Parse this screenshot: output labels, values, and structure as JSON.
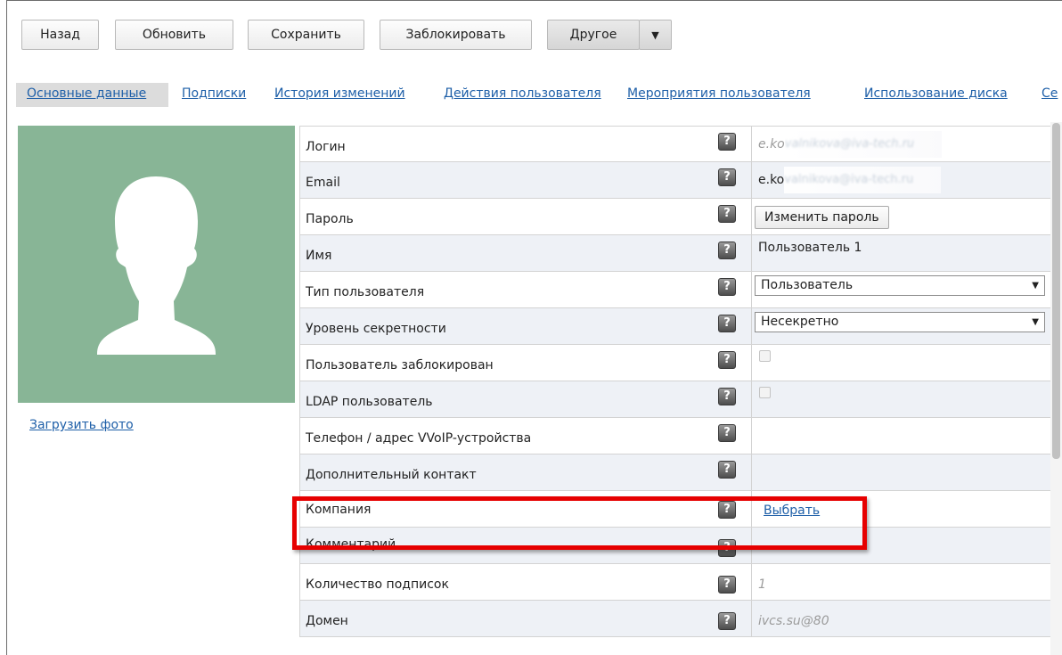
{
  "toolbar": {
    "back": "Назад",
    "refresh": "Обновить",
    "save": "Сохранить",
    "block": "Заблокировать",
    "other": "Другое",
    "other_arrow": "▼"
  },
  "tabs": [
    {
      "label": "Основные данные",
      "active": true
    },
    {
      "label": "Подписки"
    },
    {
      "label": "История изменений"
    },
    {
      "label": "Действия пользователя"
    },
    {
      "label": "Мероприятия пользователя"
    },
    {
      "label": "Использование диска"
    },
    {
      "label": "Се"
    }
  ],
  "avatar": {
    "bg_color": "#88b596",
    "icon": "user-silhouette-icon"
  },
  "upload_photo": "Загрузить фото",
  "help_symbol": "?",
  "fields": {
    "login": {
      "label": "Логин",
      "value": "e.ko",
      "blurred": "valnikova@iva-tech.ru"
    },
    "email": {
      "label": "Email",
      "value": "e.ko",
      "blurred": "valnikova@iva-tech.ru"
    },
    "password": {
      "label": "Пароль",
      "button": "Изменить пароль"
    },
    "name": {
      "label": "Имя",
      "value": "Пользователь 1"
    },
    "user_type": {
      "label": "Тип пользователя",
      "value": "Пользователь",
      "arrow": "▼"
    },
    "secrecy": {
      "label": "Уровень секретности",
      "value": "Несекретно",
      "arrow": "▼"
    },
    "blocked": {
      "label": "Пользователь заблокирован",
      "checked": false
    },
    "ldap": {
      "label": "LDAP пользователь",
      "checked": false
    },
    "phone": {
      "label": "Телефон / адрес VVoIP-устройства"
    },
    "extra_contact": {
      "label": "Дополнительный контакт"
    },
    "company": {
      "label": "Компания",
      "link": "Выбрать"
    },
    "comment": {
      "label": "Комментарий"
    },
    "subscriptions": {
      "label": "Количество подписок",
      "value": "1"
    },
    "domain": {
      "label": "Домен",
      "value": "ivcs.su@80"
    }
  },
  "colors": {
    "link": "#1e5fa8",
    "highlight": "#e60000",
    "row_alt": "#eef1f6"
  }
}
